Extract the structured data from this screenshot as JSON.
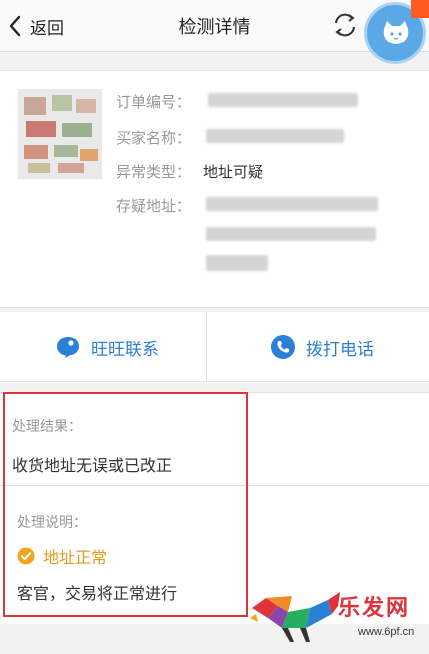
{
  "nav": {
    "back_label": "返回",
    "title": "检测详情"
  },
  "order": {
    "order_no_label": "订单编号：",
    "buyer_label": "买家名称：",
    "abnormal_type_label": "异常类型：",
    "abnormal_type_value": "地址可疑",
    "suspect_address_label": "存疑地址："
  },
  "actions": {
    "wangwang_label": "旺旺联系",
    "call_label": "拨打电话"
  },
  "result": {
    "result_label": "处理结果：",
    "result_value": "收货地址无误或已改正",
    "note_label": "处理说明：",
    "status_label": "地址正常",
    "status_color": "#f0a51e",
    "note_text": "客官，交易将正常进行"
  },
  "colors": {
    "accent_blue": "#2a7fd6",
    "highlight_red": "#e0323a"
  },
  "watermark": {
    "brand": "乐发网",
    "url": "www.6pf.cn"
  }
}
